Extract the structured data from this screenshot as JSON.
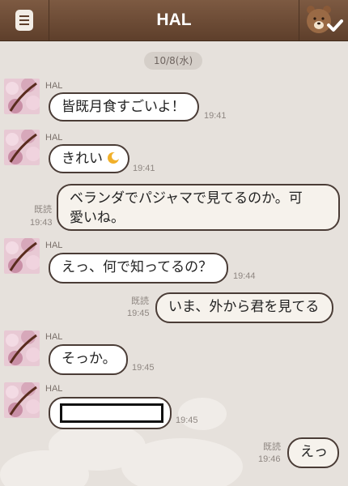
{
  "header": {
    "title": "HAL"
  },
  "chat": {
    "date": "10/8(水)",
    "messages": [
      {
        "sender": "HAL",
        "text": "皆既月食すごいよ！",
        "time": "19:41"
      },
      {
        "sender": "HAL",
        "text": "きれい",
        "emoji": "moon-emoji",
        "time": "19:41"
      },
      {
        "side": "me",
        "read": "既読",
        "text_line1": "ベランダでパジャマで見てるのか。可",
        "text_line2": "愛いね。",
        "time": "19:43"
      },
      {
        "sender": "HAL",
        "text": "えっ、何で知ってるの？",
        "time": "19:44"
      },
      {
        "side": "me",
        "read": "既読",
        "text": "いま、外から君を見てる",
        "time": "19:45"
      },
      {
        "sender": "HAL",
        "text": "そっか。",
        "time": "19:45"
      },
      {
        "sender": "HAL",
        "content": "blank-image",
        "time": "19:45"
      },
      {
        "side": "me",
        "read": "既読",
        "text": "えっ",
        "time": "19:46"
      }
    ]
  },
  "colors": {
    "header": "#6b4a35",
    "bubble_border": "#4a3c36",
    "chat_bg": "#e6e1dc"
  }
}
